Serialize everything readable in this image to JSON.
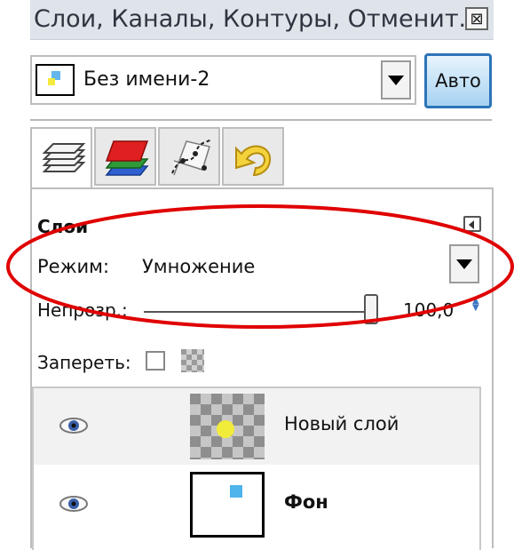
{
  "window": {
    "title": "Слои, Каналы, Контуры, Отменит...",
    "close_glyph": "⊠"
  },
  "image_selector": {
    "name": "Без имени-2",
    "auto_label": "Авто"
  },
  "tabs": [
    {
      "name": "layers-icon"
    },
    {
      "name": "channels-icon"
    },
    {
      "name": "paths-icon"
    },
    {
      "name": "undo-icon"
    }
  ],
  "layers_panel": {
    "title": "Слои",
    "mode": {
      "label": "Режим:",
      "value": "Умножение"
    },
    "opacity": {
      "label": "Непрозр.:",
      "value": "100,0",
      "fraction": 1.0
    },
    "lock": {
      "label": "Запереть:"
    },
    "layers": [
      {
        "name": "Новый слой",
        "visible": true,
        "bold": false
      },
      {
        "name": "Фон",
        "visible": true,
        "bold": true
      }
    ]
  },
  "colors": {
    "annotation": "#e00000",
    "accent": "#2c74b8"
  }
}
